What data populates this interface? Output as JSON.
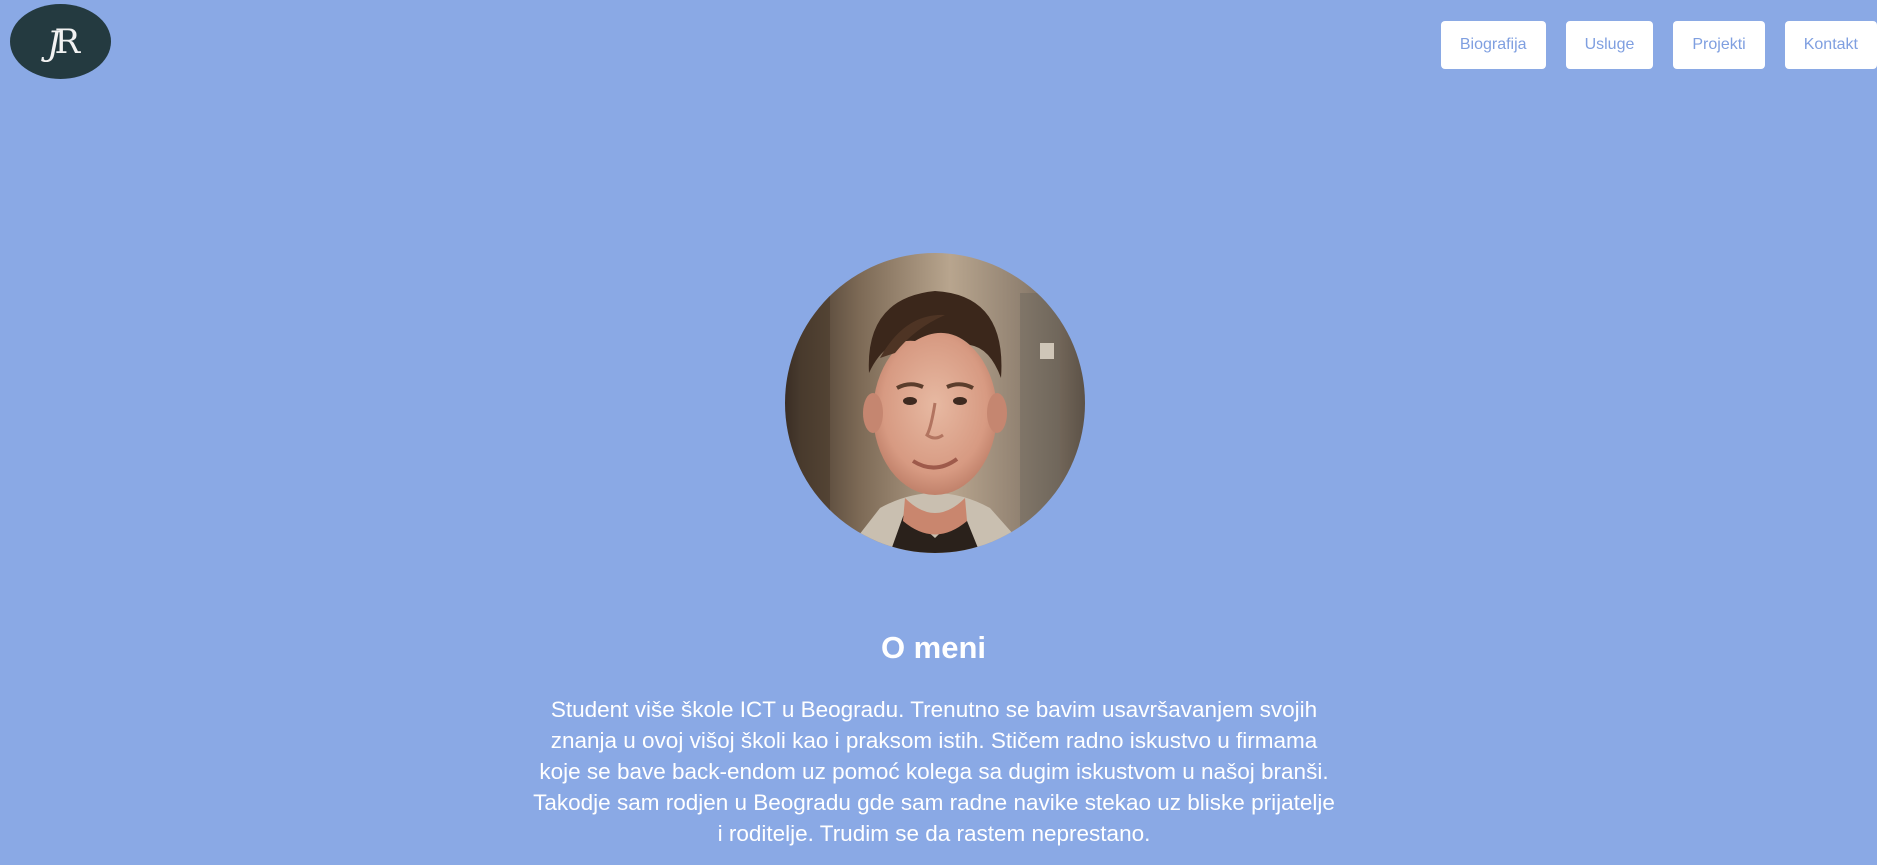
{
  "logo": {
    "text": "JR",
    "icon": "monogram-logo"
  },
  "nav": {
    "items": [
      {
        "label": "Biografija"
      },
      {
        "label": "Usluge"
      },
      {
        "label": "Projekti"
      },
      {
        "label": "Kontakt"
      }
    ]
  },
  "profile": {
    "photo": "profile-photo",
    "heading": "O meni",
    "bio": "Student više škole ICT u Beogradu. Trenutno se bavim usavršavanjem svojih znanja u ovoj višoj školi kao i praksom istih. Stičem radno iskustvo u firmama koje se bave back-endom uz pomoć kolega sa dugim iskustvom u našoj branši. Takodje sam rodjen u Beogradu gde sam radne navike stekao uz bliske prijatelje i roditelje. Trudim se da rastem neprestano."
  },
  "colors": {
    "background": "#8aa9e5",
    "logo_bg": "#243a40",
    "nav_text": "#7f9fe0",
    "nav_bg": "#ffffff",
    "text": "#ffffff"
  }
}
